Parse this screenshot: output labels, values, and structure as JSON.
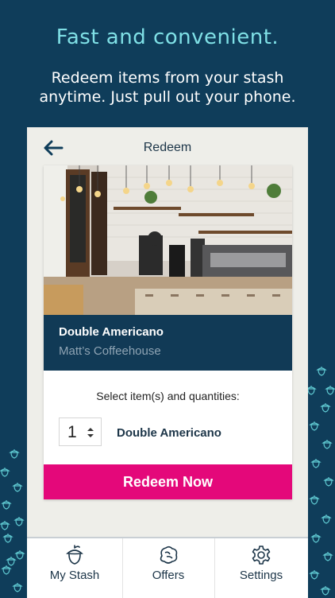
{
  "promo": {
    "headline": "Fast and convenient.",
    "subline": "Redeem items from your stash anytime. Just pull out your phone."
  },
  "colors": {
    "background": "#0f3d5a",
    "accent_teal": "#7fe0e6",
    "redeem_pink": "#e4087a",
    "info_panel": "#113a56"
  },
  "app": {
    "title": "Redeem",
    "back_icon": "back-arrow-icon",
    "item": {
      "name": "Double Americano",
      "shop": "Matt’s Coffeehouse"
    },
    "instruction": "Select item(s) and quantities:",
    "quantity": {
      "value": "1",
      "item_label": "Double Americano"
    },
    "redeem_button": "Redeem Now",
    "tabs": [
      {
        "label": "My Stash",
        "icon": "acorn-icon"
      },
      {
        "label": "Offers",
        "icon": "offers-icon"
      },
      {
        "label": "Settings",
        "icon": "gear-icon"
      }
    ]
  }
}
